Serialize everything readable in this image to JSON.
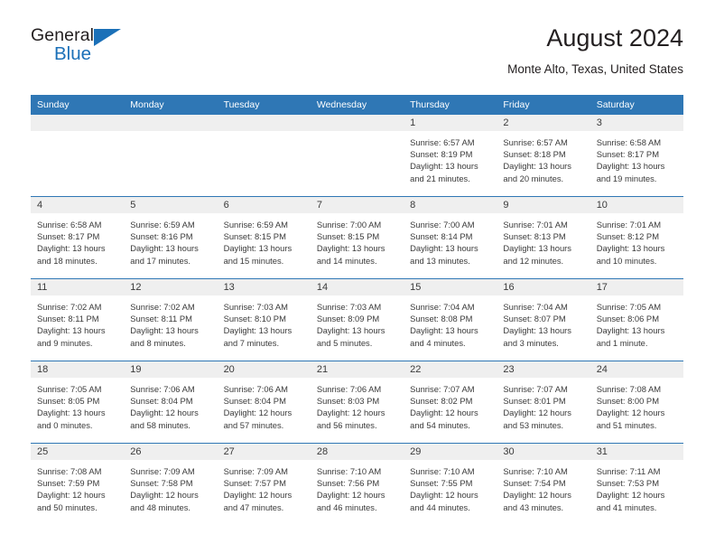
{
  "brand": {
    "name_part1": "General",
    "name_part2": "Blue",
    "accent_color": "#1b70b8"
  },
  "header": {
    "title": "August 2024",
    "location": "Monte Alto, Texas, United States"
  },
  "calendar": {
    "header_color": "#2f77b5",
    "weekday_headers": [
      "Sunday",
      "Monday",
      "Tuesday",
      "Wednesday",
      "Thursday",
      "Friday",
      "Saturday"
    ],
    "weeks": [
      [
        {
          "day": "",
          "text": ""
        },
        {
          "day": "",
          "text": ""
        },
        {
          "day": "",
          "text": ""
        },
        {
          "day": "",
          "text": ""
        },
        {
          "day": "1",
          "text": "Sunrise: 6:57 AM\nSunset: 8:19 PM\nDaylight: 13 hours and 21 minutes."
        },
        {
          "day": "2",
          "text": "Sunrise: 6:57 AM\nSunset: 8:18 PM\nDaylight: 13 hours and 20 minutes."
        },
        {
          "day": "3",
          "text": "Sunrise: 6:58 AM\nSunset: 8:17 PM\nDaylight: 13 hours and 19 minutes."
        }
      ],
      [
        {
          "day": "4",
          "text": "Sunrise: 6:58 AM\nSunset: 8:17 PM\nDaylight: 13 hours and 18 minutes."
        },
        {
          "day": "5",
          "text": "Sunrise: 6:59 AM\nSunset: 8:16 PM\nDaylight: 13 hours and 17 minutes."
        },
        {
          "day": "6",
          "text": "Sunrise: 6:59 AM\nSunset: 8:15 PM\nDaylight: 13 hours and 15 minutes."
        },
        {
          "day": "7",
          "text": "Sunrise: 7:00 AM\nSunset: 8:15 PM\nDaylight: 13 hours and 14 minutes."
        },
        {
          "day": "8",
          "text": "Sunrise: 7:00 AM\nSunset: 8:14 PM\nDaylight: 13 hours and 13 minutes."
        },
        {
          "day": "9",
          "text": "Sunrise: 7:01 AM\nSunset: 8:13 PM\nDaylight: 13 hours and 12 minutes."
        },
        {
          "day": "10",
          "text": "Sunrise: 7:01 AM\nSunset: 8:12 PM\nDaylight: 13 hours and 10 minutes."
        }
      ],
      [
        {
          "day": "11",
          "text": "Sunrise: 7:02 AM\nSunset: 8:11 PM\nDaylight: 13 hours and 9 minutes."
        },
        {
          "day": "12",
          "text": "Sunrise: 7:02 AM\nSunset: 8:11 PM\nDaylight: 13 hours and 8 minutes."
        },
        {
          "day": "13",
          "text": "Sunrise: 7:03 AM\nSunset: 8:10 PM\nDaylight: 13 hours and 7 minutes."
        },
        {
          "day": "14",
          "text": "Sunrise: 7:03 AM\nSunset: 8:09 PM\nDaylight: 13 hours and 5 minutes."
        },
        {
          "day": "15",
          "text": "Sunrise: 7:04 AM\nSunset: 8:08 PM\nDaylight: 13 hours and 4 minutes."
        },
        {
          "day": "16",
          "text": "Sunrise: 7:04 AM\nSunset: 8:07 PM\nDaylight: 13 hours and 3 minutes."
        },
        {
          "day": "17",
          "text": "Sunrise: 7:05 AM\nSunset: 8:06 PM\nDaylight: 13 hours and 1 minute."
        }
      ],
      [
        {
          "day": "18",
          "text": "Sunrise: 7:05 AM\nSunset: 8:05 PM\nDaylight: 13 hours and 0 minutes."
        },
        {
          "day": "19",
          "text": "Sunrise: 7:06 AM\nSunset: 8:04 PM\nDaylight: 12 hours and 58 minutes."
        },
        {
          "day": "20",
          "text": "Sunrise: 7:06 AM\nSunset: 8:04 PM\nDaylight: 12 hours and 57 minutes."
        },
        {
          "day": "21",
          "text": "Sunrise: 7:06 AM\nSunset: 8:03 PM\nDaylight: 12 hours and 56 minutes."
        },
        {
          "day": "22",
          "text": "Sunrise: 7:07 AM\nSunset: 8:02 PM\nDaylight: 12 hours and 54 minutes."
        },
        {
          "day": "23",
          "text": "Sunrise: 7:07 AM\nSunset: 8:01 PM\nDaylight: 12 hours and 53 minutes."
        },
        {
          "day": "24",
          "text": "Sunrise: 7:08 AM\nSunset: 8:00 PM\nDaylight: 12 hours and 51 minutes."
        }
      ],
      [
        {
          "day": "25",
          "text": "Sunrise: 7:08 AM\nSunset: 7:59 PM\nDaylight: 12 hours and 50 minutes."
        },
        {
          "day": "26",
          "text": "Sunrise: 7:09 AM\nSunset: 7:58 PM\nDaylight: 12 hours and 48 minutes."
        },
        {
          "day": "27",
          "text": "Sunrise: 7:09 AM\nSunset: 7:57 PM\nDaylight: 12 hours and 47 minutes."
        },
        {
          "day": "28",
          "text": "Sunrise: 7:10 AM\nSunset: 7:56 PM\nDaylight: 12 hours and 46 minutes."
        },
        {
          "day": "29",
          "text": "Sunrise: 7:10 AM\nSunset: 7:55 PM\nDaylight: 12 hours and 44 minutes."
        },
        {
          "day": "30",
          "text": "Sunrise: 7:10 AM\nSunset: 7:54 PM\nDaylight: 12 hours and 43 minutes."
        },
        {
          "day": "31",
          "text": "Sunrise: 7:11 AM\nSunset: 7:53 PM\nDaylight: 12 hours and 41 minutes."
        }
      ]
    ]
  }
}
